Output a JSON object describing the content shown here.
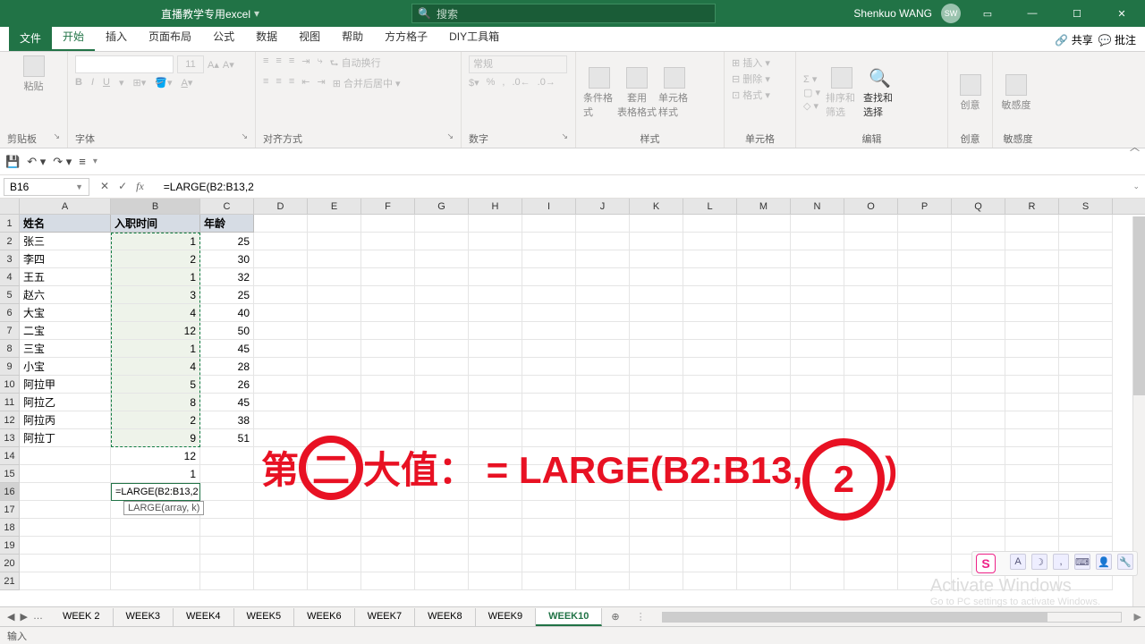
{
  "titlebar": {
    "document": "直播教学专用excel",
    "search_placeholder": "搜索",
    "user": "Shenkuo WANG",
    "avatar": "SW"
  },
  "tabs": {
    "file": "文件",
    "items": [
      "开始",
      "插入",
      "页面布局",
      "公式",
      "数据",
      "视图",
      "帮助",
      "方方格子",
      "DIY工具箱"
    ],
    "active_index": 0,
    "share": "共享",
    "comments": "批注"
  },
  "ribbon_groups": {
    "clipboard": "剪贴板",
    "font": "字体",
    "alignment": "对齐方式",
    "number": "数字",
    "styles": "样式",
    "cells": "单元格",
    "editing": "编辑",
    "ideas": "创意",
    "sensitivity": "敏感度",
    "paste": "粘贴",
    "wrap": "自动换行",
    "merge": "合并后居中 ▾",
    "cond_fmt": "条件格式",
    "as_table": "套用\n表格格式",
    "cell_styles": "单元格样式",
    "insert": "插入",
    "delete": "删除",
    "format": "格式",
    "sort_filter": "排序和筛选",
    "find_select": "查找和选择",
    "ideas_btn": "创意",
    "sens_btn": "敏感度",
    "font_size": "11",
    "number_fmt": "常规"
  },
  "namebox": "B16",
  "formula": "=LARGE(B2:B13,2",
  "columns": [
    "A",
    "B",
    "C",
    "D",
    "E",
    "F",
    "G",
    "H",
    "I",
    "J",
    "K",
    "L",
    "M",
    "N",
    "O",
    "P",
    "Q",
    "R",
    "S"
  ],
  "col_widths": {
    "A": 102,
    "B": 100,
    "default": 60
  },
  "headers": {
    "A": "姓名",
    "B": "入职时间",
    "C": "年龄"
  },
  "chart_data": {
    "type": "table",
    "columns": [
      "姓名",
      "入职时间",
      "年龄"
    ],
    "rows": [
      [
        "张三",
        1,
        25
      ],
      [
        "李四",
        2,
        30
      ],
      [
        "王五",
        1,
        32
      ],
      [
        "赵六",
        3,
        25
      ],
      [
        "大宝",
        4,
        40
      ],
      [
        "二宝",
        12,
        50
      ],
      [
        "三宝",
        1,
        45
      ],
      [
        "小宝",
        4,
        28
      ],
      [
        "阿拉甲",
        5,
        26
      ],
      [
        "阿拉乙",
        8,
        45
      ],
      [
        "阿拉丙",
        2,
        38
      ],
      [
        "阿拉丁",
        9,
        51
      ]
    ],
    "extra_B": {
      "14": 12,
      "15": 1
    }
  },
  "editing_cell_text": "=LARGE(B2:B13,2",
  "formula_hint": "LARGE(array, k)",
  "annotation": {
    "prefix": "第",
    "circ1": "二",
    "mid": "大值：  =  LARGE(B2:B13,",
    "circ2": "2",
    "suffix": ")"
  },
  "sheets": {
    "tabs": [
      "WEEK 2",
      "WEEK3",
      "WEEK4",
      "WEEK5",
      "WEEK6",
      "WEEK7",
      "WEEK8",
      "WEEK9",
      "WEEK10"
    ],
    "active_index": 8,
    "more": "…"
  },
  "status": "输入",
  "watermark": {
    "line1": "Activate Windows",
    "line2": "Go to PC settings to activate Windows."
  }
}
